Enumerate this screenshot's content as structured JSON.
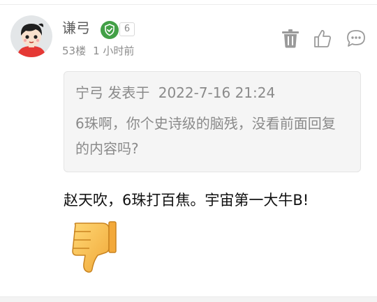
{
  "user": {
    "name": "谦弓",
    "level": "6",
    "floor": "53楼",
    "time": "1 小时前"
  },
  "quote": {
    "author": "宁弓",
    "posted_label": "发表于",
    "posted_time": "2022-7-16 21:24",
    "text": "6珠啊，你个史诗级的脑残，没看前面回复的内容吗?"
  },
  "comment": {
    "text": "赵天吹，6珠打百焦。宇宙第一大牛B!"
  },
  "icons": {
    "verify": "shield-check-icon",
    "delete": "trash-icon",
    "like": "thumbs-up-icon",
    "reply": "speech-bubble-icon",
    "emoji": "thumbs-down-emoji"
  },
  "colors": {
    "verify_green": "#43a047",
    "icon_gray": "#9a9a9a",
    "quote_bg": "#f5f5f5"
  }
}
